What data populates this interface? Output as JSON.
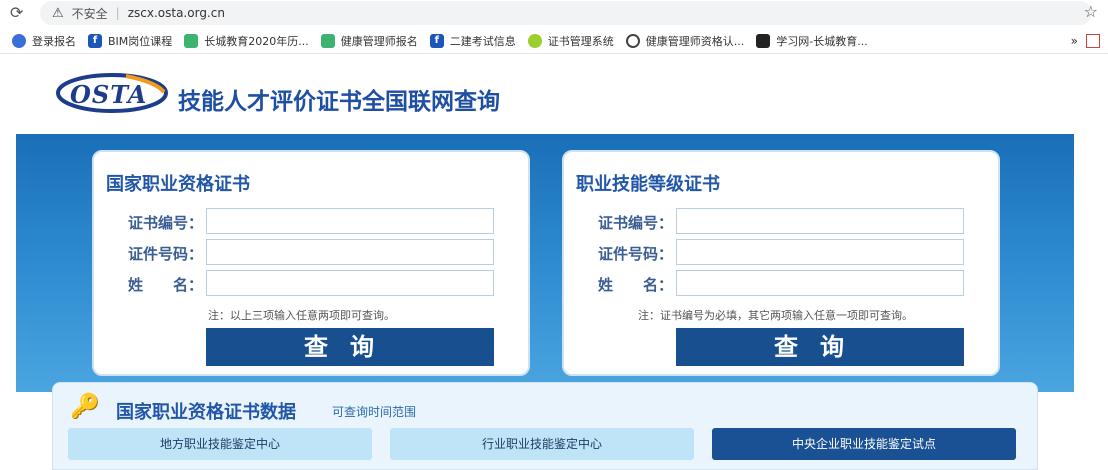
{
  "browser": {
    "insecure": "不安全",
    "url": "zscx.osta.org.cn"
  },
  "bookmarks": [
    {
      "label": "登录报名",
      "icon": "blue"
    },
    {
      "label": "BIM岗位课程",
      "icon": "f"
    },
    {
      "label": "长城教育2020年历...",
      "icon": "green"
    },
    {
      "label": "健康管理师报名",
      "icon": "green"
    },
    {
      "label": "二建考试信息",
      "icon": "f"
    },
    {
      "label": "证书管理系统",
      "icon": "lime"
    },
    {
      "label": "健康管理师资格认...",
      "icon": "circ"
    },
    {
      "label": "学习网-长城教育...",
      "icon": "dark"
    }
  ],
  "header": {
    "logo": "OSTA",
    "title": "技能人才评价证书全国联网查询"
  },
  "left_panel": {
    "title": "国家职业资格证书",
    "fields": [
      "证书编号：",
      "证件号码：",
      "姓　　名："
    ],
    "note": "注：以上三项输入任意两项即可查询。",
    "button": "查询"
  },
  "right_panel": {
    "title": "职业技能等级证书",
    "fields": [
      "证书编号：",
      "证件号码：",
      "姓　　名："
    ],
    "note": "注：证书编号为必填，其它两项输入任意一项即可查询。",
    "button": "查询"
  },
  "bottom": {
    "title": "国家职业资格证书数据",
    "subtitle": "可查询时间范围",
    "tabs": [
      "地方职业技能鉴定中心",
      "行业职业技能鉴定中心",
      "中央企业职业技能鉴定试点"
    ]
  }
}
